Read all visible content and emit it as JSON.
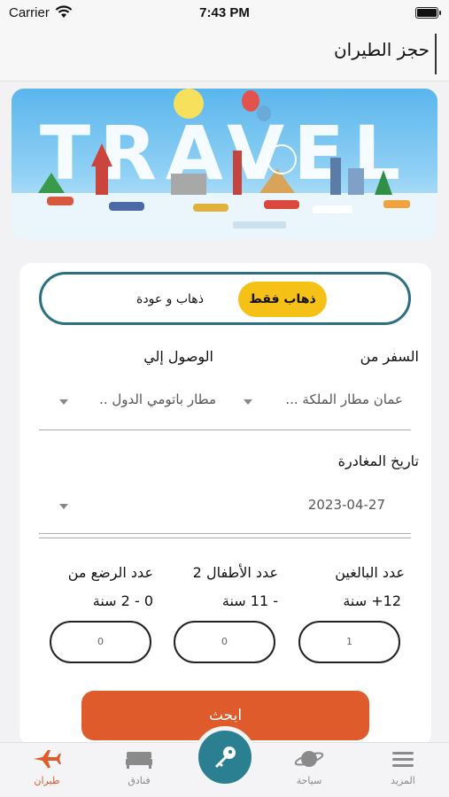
{
  "status_bar": {
    "carrier": "Carrier",
    "time": "7:43 PM"
  },
  "nav": {
    "title": "حجز الطيران"
  },
  "banner": {
    "word": "TRAVEL"
  },
  "trip_type": {
    "options": [
      "ذهاب فقط",
      "ذهاب و عودة"
    ],
    "selected": "ذهاب فقط"
  },
  "form": {
    "from_label": "السفر من",
    "from_value": "عمان مطار الملكة ...",
    "to_label": "الوصول إلي",
    "to_value": "مطار باتومي الدول ..",
    "departure_label": "تاريخ المغادرة",
    "departure_value": "2023-04-27",
    "adults_label": "عدد البالغين",
    "adults_range": "12+ سنة",
    "adults_value": "1",
    "children_label": "عدد الأطفال 2",
    "children_range": "- 11 سنة",
    "children_value": "0",
    "infants_label": "عدد الرضع من",
    "infants_range": "0 - 2 سنة",
    "infants_value": "0",
    "search_label": "ابحث"
  },
  "tabs": [
    {
      "label": "المزيد",
      "icon": "menu-icon"
    },
    {
      "label": "سياحة",
      "icon": "planet-icon"
    },
    {
      "label": "فنادق",
      "icon": "bed-icon"
    },
    {
      "label": "طيران",
      "icon": "airplane-icon"
    }
  ],
  "center_button": {
    "icon": "key-icon"
  },
  "colors": {
    "accent": "#e05b2b",
    "highlight": "#f5c117",
    "teal": "#2a7f91"
  }
}
